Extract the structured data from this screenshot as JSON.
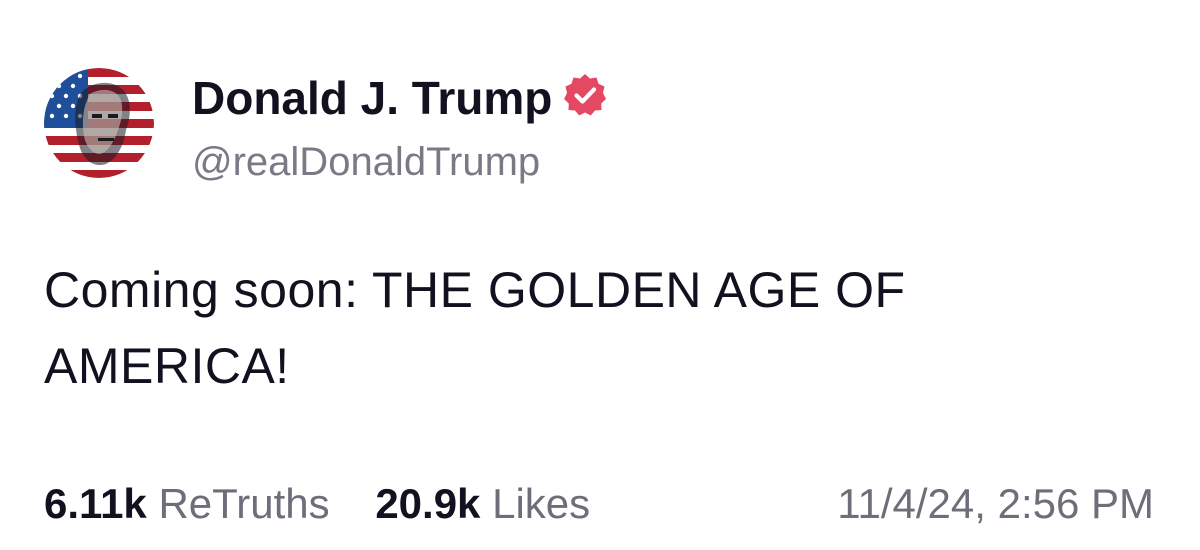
{
  "author": {
    "display_name": "Donald J. Trump",
    "handle": "@realDonaldTrump",
    "verified": true,
    "verified_badge_color": "#e54862"
  },
  "avatar": {
    "icon": "flag-portrait-avatar",
    "colors": [
      "#b3202b",
      "#ffffff",
      "#1f4e9a"
    ]
  },
  "post": {
    "text_line1": "Coming soon: THE GOLDEN AGE OF",
    "text_line2": "AMERICA!"
  },
  "stats": {
    "retruths_count": "6.11k",
    "retruths_label": "ReTruths",
    "likes_count": "20.9k",
    "likes_label": "Likes"
  },
  "timestamp": "11/4/24, 2:56 PM"
}
